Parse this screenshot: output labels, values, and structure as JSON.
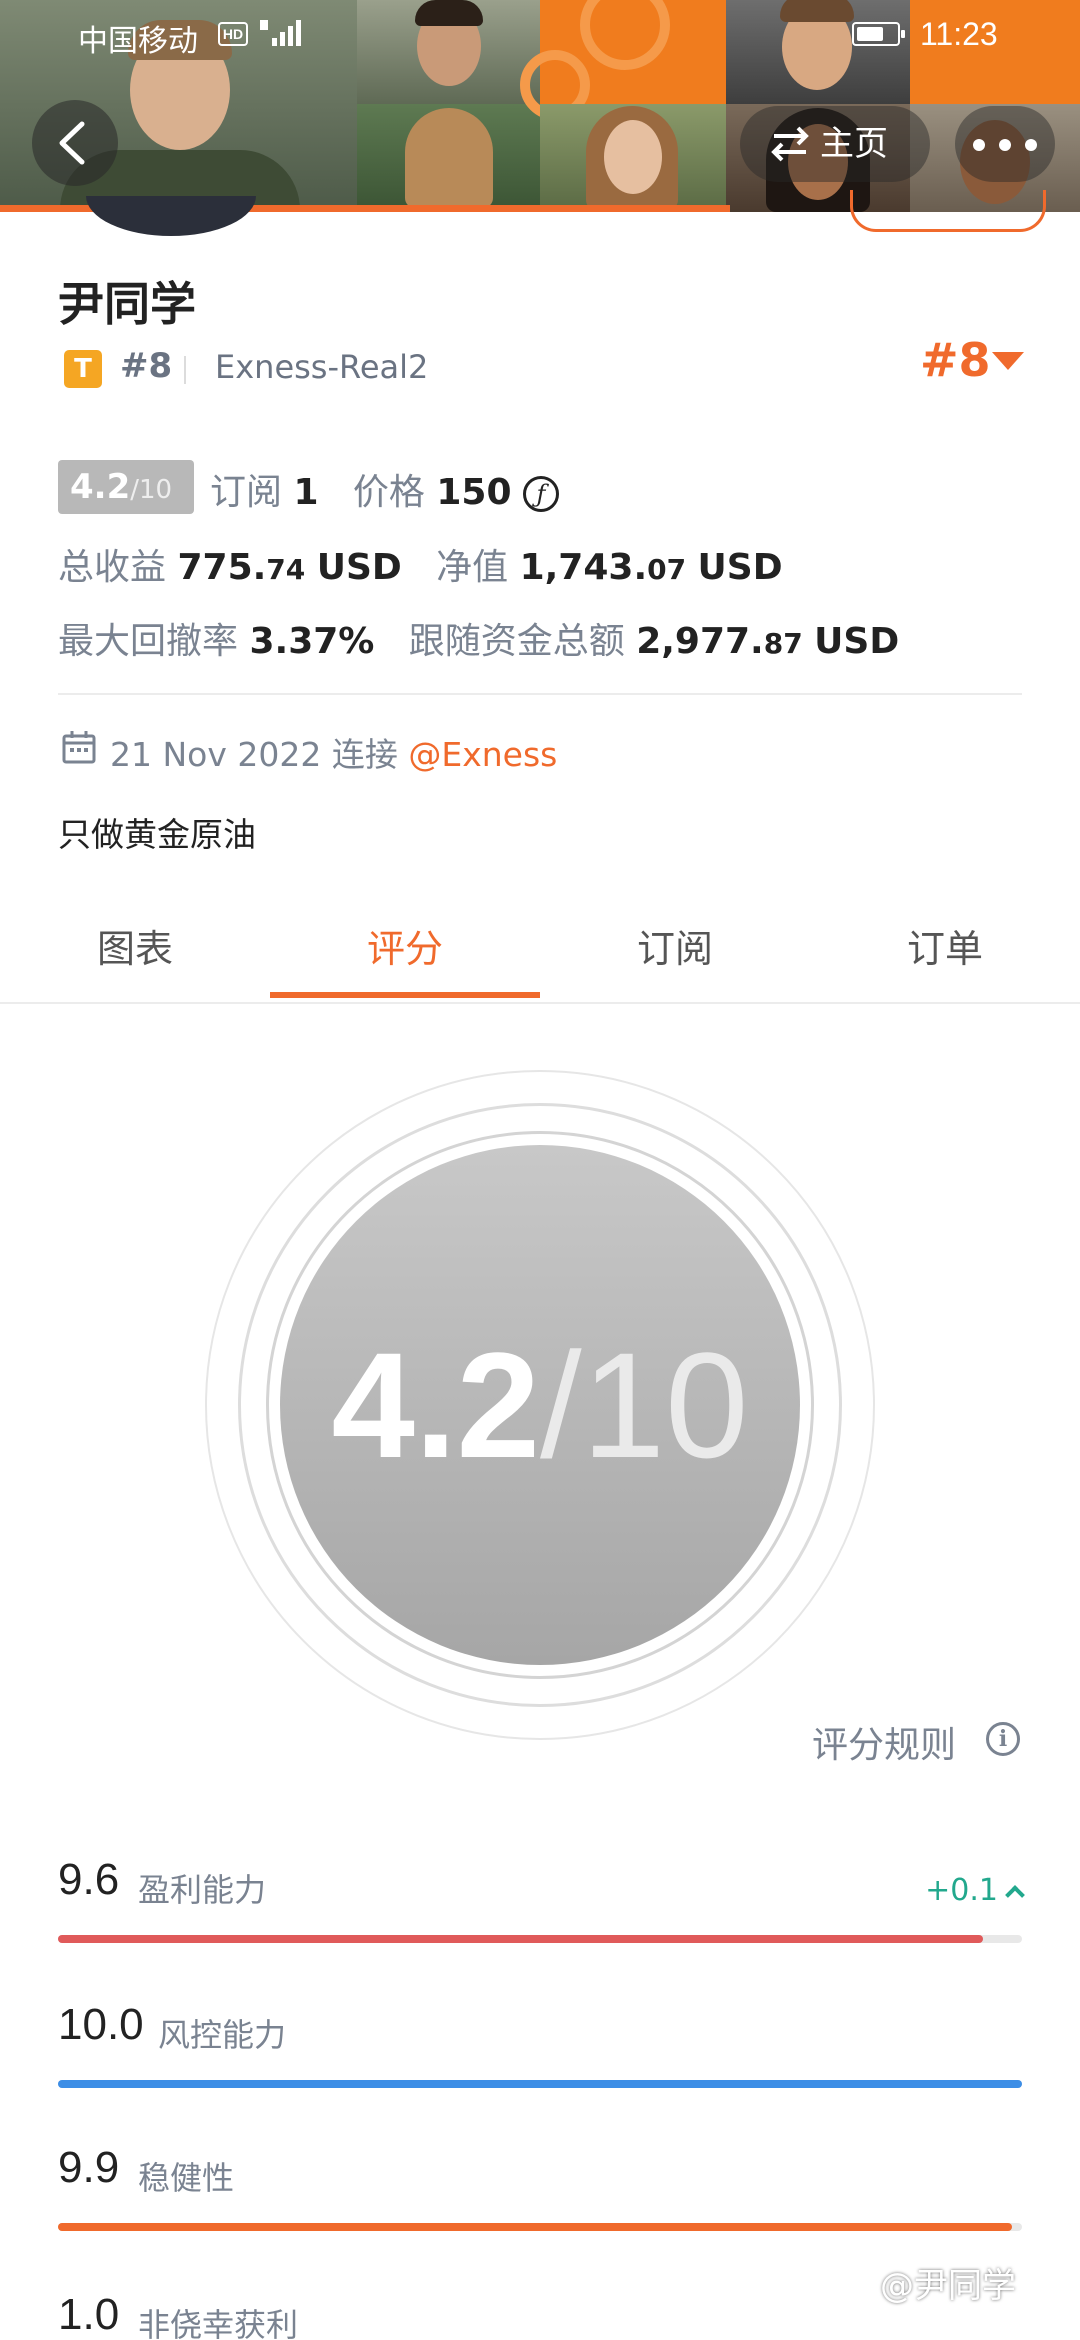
{
  "status_bar": {
    "carrier": "中国移动",
    "hd": "HD",
    "time": "11:23"
  },
  "header": {
    "home_label": "主页"
  },
  "profile": {
    "name": "尹同学",
    "type_badge": "T",
    "rank": "#8",
    "server": "Exness-Real2",
    "rank_big": "#8",
    "score_value": "4.2",
    "score_den": "/10",
    "subscribe_label": "订阅",
    "subscribe_value": "1",
    "price_label": "价格",
    "price_value": "150",
    "price_currency_symbol": "ƒ",
    "total_profit_label": "总收益",
    "total_profit_int": "775.",
    "total_profit_dec": "74",
    "total_profit_unit": "USD",
    "equity_label": "净值",
    "equity_int": "1,743.",
    "equity_dec": "07",
    "equity_unit": "USD",
    "max_drawdown_label": "最大回撤率",
    "max_drawdown_value": "3.37%",
    "follow_funds_label": "跟随资金总额",
    "follow_funds_int": "2,977.",
    "follow_funds_dec": "87",
    "follow_funds_unit": "USD",
    "joined_date": "21 Nov 2022",
    "joined_text": "连接",
    "broker_link": "@Exness",
    "bio": "只做黄金原油"
  },
  "tabs": [
    {
      "label": "图表"
    },
    {
      "label": "评分"
    },
    {
      "label": "订阅"
    },
    {
      "label": "订单"
    }
  ],
  "active_tab": "评分",
  "rating": {
    "value": "4.2",
    "den": "/10",
    "rules_label": "评分规则"
  },
  "metrics": [
    {
      "value": "9.6",
      "label": "盈利能力",
      "fraction": 0.96,
      "color": "#e05a5a",
      "delta": "+0.1"
    },
    {
      "value": "10.0",
      "label": "风控能力",
      "fraction": 1.0,
      "color": "#3d8ee6"
    },
    {
      "value": "9.9",
      "label": "稳健性",
      "fraction": 0.99,
      "color": "#f06a2c"
    },
    {
      "value": "1.0",
      "label": "非侥幸获利"
    }
  ],
  "watermark": "@尹同学",
  "colors": {
    "accent": "#f06a2c",
    "positive": "#22a88d"
  }
}
